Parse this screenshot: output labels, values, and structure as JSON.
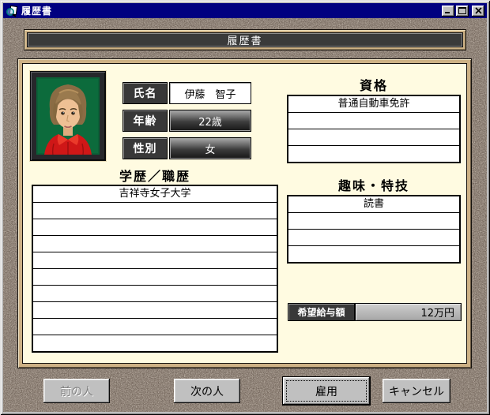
{
  "window": {
    "title": "履歴書"
  },
  "banner": {
    "title": "履歴書"
  },
  "applicant": {
    "fields": [
      {
        "label": "氏名",
        "value": "伊藤　智子"
      },
      {
        "label": "年齢",
        "value": "22歳"
      },
      {
        "label": "性別",
        "value": "女"
      }
    ]
  },
  "qualifications": {
    "title": "資格",
    "rows": [
      "普通自動車免許",
      "",
      "",
      ""
    ]
  },
  "education": {
    "title": "学歴／職歴",
    "rows": [
      "吉祥寺女子大学",
      "",
      "",
      "",
      "",
      "",
      "",
      "",
      "",
      ""
    ]
  },
  "hobbies": {
    "title": "趣味・特技",
    "rows": [
      "読書",
      "",
      "",
      ""
    ]
  },
  "salary": {
    "label": "希望給与額",
    "value": "12万円"
  },
  "buttons": {
    "prev": {
      "label": "前の人",
      "state": "disabled"
    },
    "next": {
      "label": "次の人",
      "state": "normal"
    },
    "hire": {
      "label": "雇用",
      "state": "focused-default"
    },
    "cancel": {
      "label": "キャンセル",
      "state": "normal"
    }
  },
  "colors": {
    "titlebar": "#000080",
    "client_background": "#6f6156",
    "frame_tan": "#cdb185",
    "panel_ivory": "#fffbe1",
    "label_dark": "#383838",
    "photo_background": "#0c6b3c",
    "button_face": "#c0c0c0"
  }
}
